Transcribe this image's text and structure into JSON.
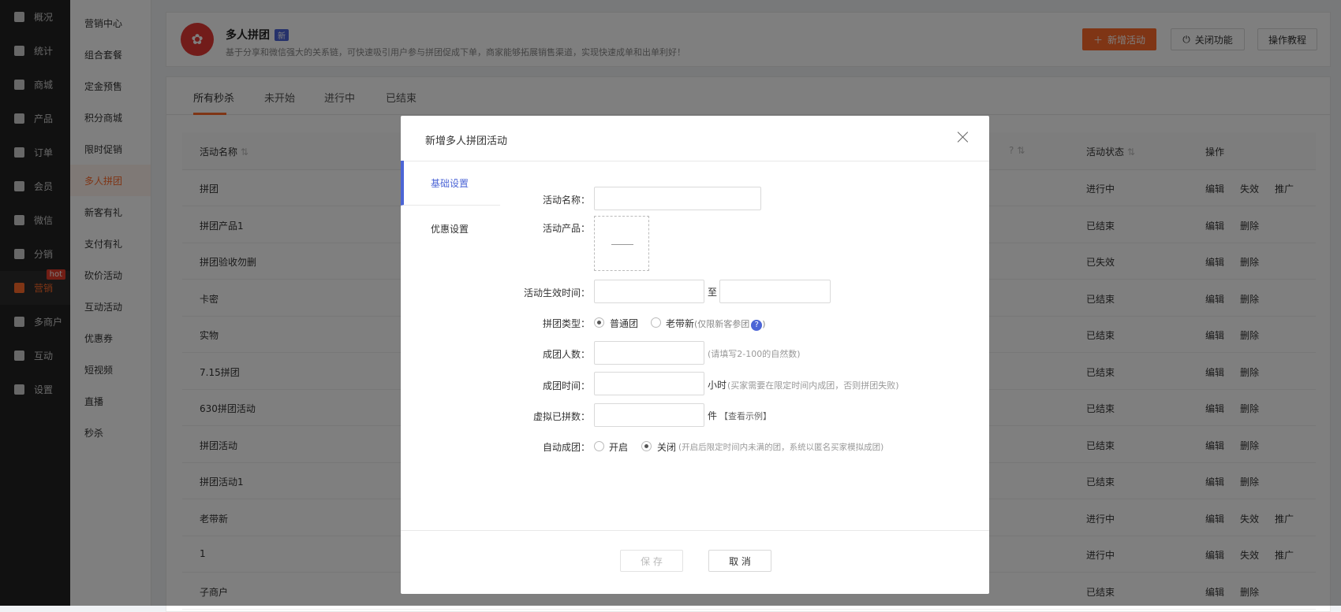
{
  "nav": {
    "items": [
      {
        "label": "概况",
        "icon": "layers-icon"
      },
      {
        "label": "统计",
        "icon": "chart-icon"
      },
      {
        "label": "商城",
        "icon": "store-icon"
      },
      {
        "label": "产品",
        "icon": "grid-icon"
      },
      {
        "label": "订单",
        "icon": "order-icon"
      },
      {
        "label": "会员",
        "icon": "crown-icon"
      },
      {
        "label": "微信",
        "icon": "wechat-icon"
      },
      {
        "label": "分销",
        "icon": "share-icon"
      },
      {
        "label": "营销",
        "icon": "flag-icon",
        "badge": "hot"
      },
      {
        "label": "多商户",
        "icon": "merchant-icon"
      },
      {
        "label": "互动",
        "icon": "interact-icon"
      },
      {
        "label": "设置",
        "icon": "gear-icon"
      }
    ]
  },
  "subnav": {
    "items": [
      "营销中心",
      "组合套餐",
      "定金预售",
      "积分商城",
      "限时促销",
      "多人拼团",
      "新客有礼",
      "支付有礼",
      "砍价活动",
      "互动活动",
      "优惠券",
      "短视频",
      "直播",
      "秒杀"
    ]
  },
  "header": {
    "title": "多人拼团",
    "badge": "新",
    "desc": "基于分享和微信强大的关系链，可快速吸引用户参与拼团促成下单，商家能够拓展销售渠道，实现快速成单和出单利好！",
    "new_btn": "新增活动",
    "close_btn": "关闭功能",
    "tutorial_btn": "操作教程"
  },
  "tabs": [
    "所有秒杀",
    "未开始",
    "进行中",
    "已结束"
  ],
  "table": {
    "col_name": "活动名称",
    "col_q": "?",
    "col_status": "活动状态",
    "col_ops": "操作",
    "rows": [
      {
        "name": "拼团",
        "status": "进行中",
        "ops": [
          "编辑",
          "失效",
          "推广"
        ]
      },
      {
        "name": "拼团产品1",
        "status": "已结束",
        "ops": [
          "编辑",
          "删除"
        ]
      },
      {
        "name": "拼团验收勿删",
        "status": "已失效",
        "ops": [
          "编辑",
          "删除"
        ]
      },
      {
        "name": "卡密",
        "status": "已结束",
        "ops": [
          "编辑",
          "删除"
        ]
      },
      {
        "name": "实物",
        "status": "已结束",
        "ops": [
          "编辑",
          "删除"
        ]
      },
      {
        "name": "7.15拼团",
        "status": "已结束",
        "ops": [
          "编辑",
          "删除"
        ]
      },
      {
        "name": "630拼团活动",
        "status": "已结束",
        "ops": [
          "编辑",
          "删除"
        ]
      },
      {
        "name": "拼团活动",
        "status": "已结束",
        "ops": [
          "编辑",
          "删除"
        ]
      },
      {
        "name": "拼团活动1",
        "status": "已结束",
        "ops": [
          "编辑",
          "删除"
        ]
      },
      {
        "name": "老带新",
        "status": "进行中",
        "ops": [
          "编辑",
          "失效",
          "推广"
        ]
      },
      {
        "name": "1",
        "status": "进行中",
        "ops": [
          "编辑",
          "失效",
          "推广"
        ]
      },
      {
        "name": "子商户",
        "status": "已结束",
        "ops": [
          "编辑",
          "删除"
        ]
      }
    ]
  },
  "modal": {
    "title": "新增多人拼团活动",
    "tab_basic": "基础设置",
    "tab_discount": "优惠设置",
    "lbl_name": "活动名称：",
    "lbl_product": "活动产品：",
    "lbl_time": "活动生效时间：",
    "time_sep": "至",
    "lbl_type": "拼团类型：",
    "type_normal": "普通团",
    "type_oldnew": "老带新",
    "type_oldnew_hint": "(仅限新客参团",
    "type_hint_close": ")",
    "lbl_count": "成团人数：",
    "count_hint": "(请填写2-100的自然数)",
    "lbl_duration": "成团时间：",
    "duration_unit": "小时",
    "duration_hint": "(买家需要在限定时间内成团，否则拼团失败)",
    "lbl_virtual": "虚拟已拼数：",
    "virtual_unit": "件",
    "virtual_link": "【查看示例】",
    "lbl_auto": "自动成团：",
    "auto_on": "开启",
    "auto_off": "关闭",
    "auto_hint": "(开启后限定时间内未满的团，系统以匿名买家模拟成团)",
    "save_btn": "保 存",
    "cancel_btn": "取 消"
  }
}
